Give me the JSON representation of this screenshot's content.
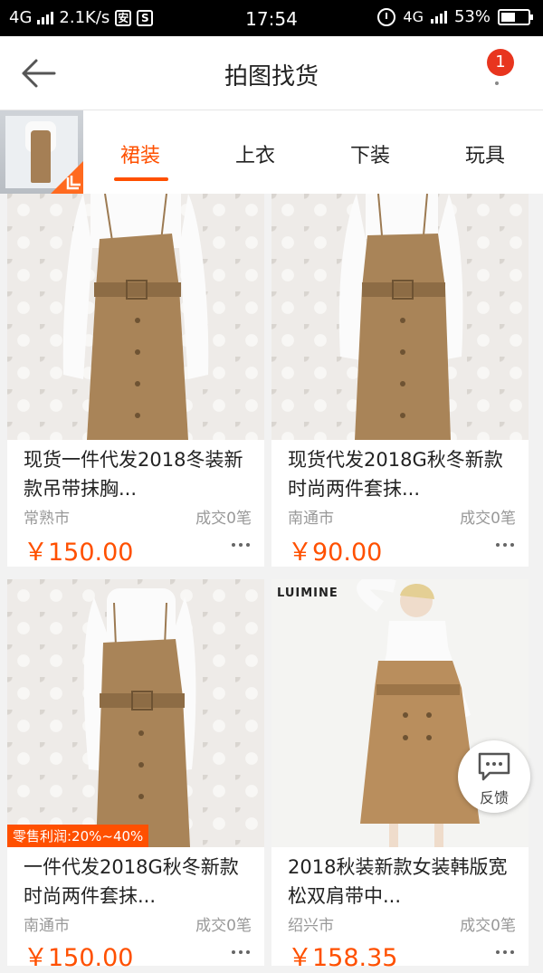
{
  "status": {
    "network": "4G",
    "speed": "2.1K/s",
    "icon_a": "安",
    "icon_b": "S",
    "time": "17:54",
    "network_right": "4G",
    "battery": "53%",
    "battery_level": 0.53
  },
  "nav": {
    "title": "拍图找货",
    "badge": "1"
  },
  "tabs": [
    "裙装",
    "上衣",
    "下装",
    "玩具"
  ],
  "products": [
    {
      "title": "现货一件代发2018冬装新款吊带抹胸...",
      "city": "常熟市",
      "deals": "成交0笔",
      "price": "￥150.00"
    },
    {
      "title": "现货代发2018G秋冬新款时尚两件套抹...",
      "city": "南通市",
      "deals": "成交0笔",
      "price": "￥90.00"
    },
    {
      "title": "一件代发2018G秋冬新款时尚两件套抹...",
      "city": "南通市",
      "deals": "成交0笔",
      "price": "￥150.00",
      "tag": "零售利润:20%~40%"
    },
    {
      "title": "2018秋装新款女装韩版宽松双肩带中...",
      "city": "绍兴市",
      "deals": "成交0笔",
      "price": "￥158.35",
      "brand": "LUIMINE"
    }
  ],
  "feedback": {
    "label": "反馈"
  }
}
